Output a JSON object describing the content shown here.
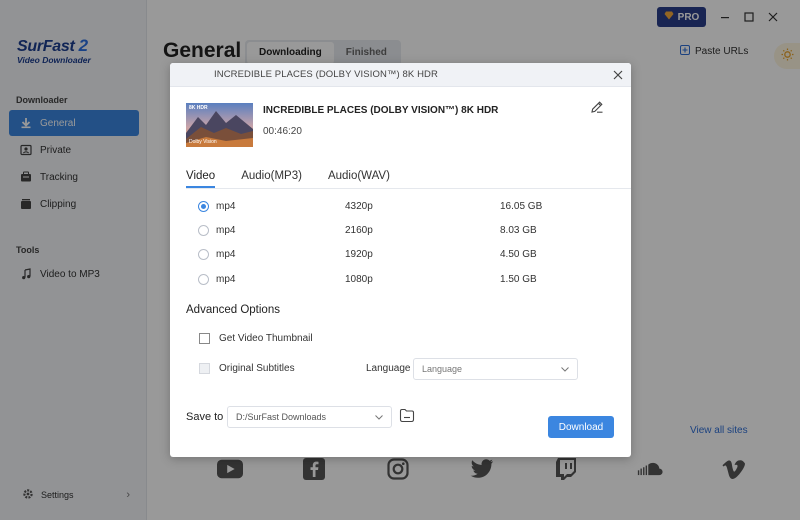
{
  "app": {
    "logo_main": "SurFast",
    "logo_version": "2",
    "logo_sub": "Video Downloader",
    "sections": {
      "downloader": "Downloader",
      "tools": "Tools"
    },
    "nav": [
      {
        "label": "General",
        "icon": "download-arrow-icon",
        "active": true
      },
      {
        "label": "Private",
        "icon": "private-box-icon",
        "active": false
      },
      {
        "label": "Tracking",
        "icon": "tracking-icon",
        "active": false
      },
      {
        "label": "Clipping",
        "icon": "clipping-icon",
        "active": false
      }
    ],
    "tools_nav": [
      {
        "label": "Video to MP3",
        "icon": "music-note-icon"
      }
    ],
    "settings_label": "Settings",
    "main_title": "General",
    "main_tabs": [
      {
        "label": "Downloading",
        "active": true
      },
      {
        "label": "Finished",
        "active": false
      }
    ],
    "paste_urls": "Paste URLs",
    "pro_label": "PRO",
    "view_all_sites": "View all sites",
    "sites": [
      "youtube-icon",
      "facebook-icon",
      "instagram-icon",
      "twitter-icon",
      "twitch-icon",
      "soundcloud-icon",
      "vimeo-icon"
    ]
  },
  "dialog": {
    "header_title": "INCREDIBLE PLACES (DOLBY VISION™) 8K HDR",
    "video_title": "INCREDIBLE PLACES (DOLBY VISION™) 8K HDR",
    "duration": "00:46:20",
    "thumb_badge": "8K HDR",
    "thumb_brand": "Dolby Vision",
    "tabs": [
      {
        "label": "Video",
        "active": true
      },
      {
        "label": "Audio(MP3)",
        "active": false
      },
      {
        "label": "Audio(WAV)",
        "active": false
      }
    ],
    "formats": [
      {
        "ext": "mp4",
        "resolution": "4320p",
        "size": "16.05 GB",
        "selected": true
      },
      {
        "ext": "mp4",
        "resolution": "2160p",
        "size": "8.03 GB",
        "selected": false
      },
      {
        "ext": "mp4",
        "resolution": "1920p",
        "size": "4.50 GB",
        "selected": false
      },
      {
        "ext": "mp4",
        "resolution": "1080p",
        "size": "1.50 GB",
        "selected": false
      }
    ],
    "advanced_title": "Advanced Options",
    "get_thumbnail_label": "Get Video Thumbnail",
    "original_subtitles_label": "Original Subtitles",
    "language_label": "Language",
    "language_value": "Language",
    "save_to_label": "Save to",
    "save_path": "D:/SurFast Downloads",
    "download_label": "Download"
  },
  "colors": {
    "accent": "#3b86e0",
    "pro_badge": "#2b3f8a",
    "logo": "#1d3f8f"
  }
}
